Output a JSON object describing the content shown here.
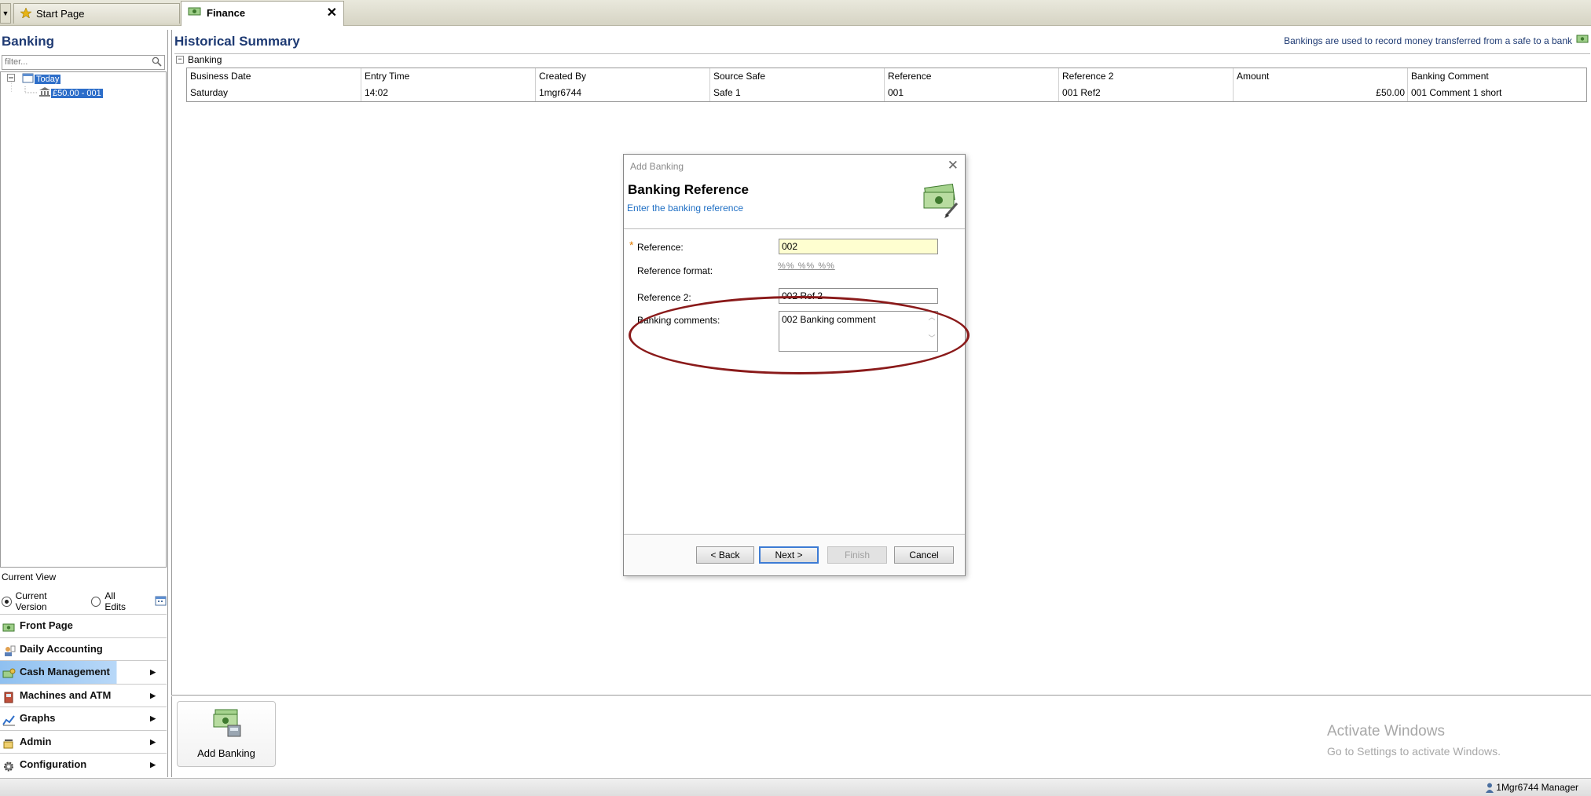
{
  "tabs": {
    "dropdown_glyph": "▼",
    "start_label": "Start Page",
    "finance_label": "Finance",
    "close_glyph": "✕"
  },
  "left": {
    "title": "Banking",
    "filter_placeholder": "filter...",
    "tree": {
      "root": "Today",
      "child": "£50.00 - 001"
    },
    "current_view_label": "Current View",
    "radio_current": "Current Version",
    "radio_all": "All Edits",
    "nav": [
      {
        "label": "Front Page",
        "arrow": ""
      },
      {
        "label": "Daily Accounting",
        "arrow": ""
      },
      {
        "label": "Cash Management",
        "arrow": "▶"
      },
      {
        "label": "Machines and ATM",
        "arrow": "▶"
      },
      {
        "label": "Graphs",
        "arrow": "▶"
      },
      {
        "label": "Admin",
        "arrow": "▶"
      },
      {
        "label": "Configuration",
        "arrow": "▶"
      }
    ]
  },
  "main": {
    "title": "Historical Summary",
    "hint": "Bankings are used to record money transferred from a safe to a bank",
    "group": "Banking",
    "group_toggle": "−",
    "columns": [
      "Business Date",
      "Entry Time",
      "Created By",
      "Source Safe",
      "Reference",
      "Reference 2",
      "Amount",
      "Banking Comment"
    ],
    "rows": [
      [
        "Saturday",
        "14:02",
        "1mgr6744",
        "Safe 1",
        "001",
        "001 Ref2",
        "£50.00",
        "001 Comment 1 short"
      ]
    ]
  },
  "dialog": {
    "title": "Add Banking",
    "close_glyph": "✕",
    "heading": "Banking Reference",
    "subheading": "Enter the banking reference",
    "required_glyph": "*",
    "reference_label": "Reference:",
    "reference_value": "002",
    "format_label": "Reference format:",
    "format_value": "%% %% %%",
    "reference2_label": "Reference 2:",
    "reference2_value": "002 Ref 2",
    "comments_label": "Banking comments:",
    "comments_value": "002 Banking comment",
    "buttons": {
      "back": "< Back",
      "next": "Next >",
      "finish": "Finish",
      "cancel": "Cancel"
    }
  },
  "ribbon": {
    "add_banking": "Add Banking"
  },
  "watermark": {
    "line1": "Activate Windows",
    "line2": "Go to Settings to activate Windows."
  },
  "status": {
    "user": "1Mgr6744 Manager"
  },
  "colors": {
    "title_blue": "#1e3a73",
    "selection_blue": "#2d6ec9",
    "annotation_red": "#8a1a1a",
    "required_orange": "#e07b00"
  }
}
